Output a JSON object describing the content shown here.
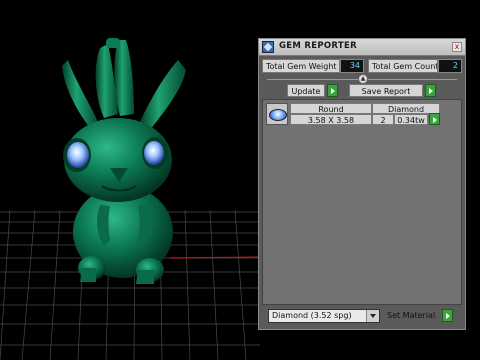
{
  "panel": {
    "title": "GEM REPORTER",
    "close_glyph": "x",
    "app_icon": "gem-icon"
  },
  "stats": {
    "total_weight_label": "Total Gem Weight",
    "total_weight_value": "34",
    "total_count_label": "Total Gem Count",
    "total_count_value": "2"
  },
  "actions": {
    "collapse_glyph": "▲",
    "update_label": "Update",
    "save_report_label": "Save Report"
  },
  "gem_table": {
    "shape": "Round",
    "material": "Diamond",
    "size": "3.58 X 3.58",
    "count": "2",
    "weight": "0.34tw"
  },
  "footer": {
    "material_selected": "Diamond     (3.52 spg)",
    "set_material_label": "Set Material"
  },
  "colors": {
    "model_green": "#0c7a55",
    "gem_blue": "#6fa8ff",
    "value_text": "#6fd0ff",
    "play_green": "#3aa53a"
  }
}
